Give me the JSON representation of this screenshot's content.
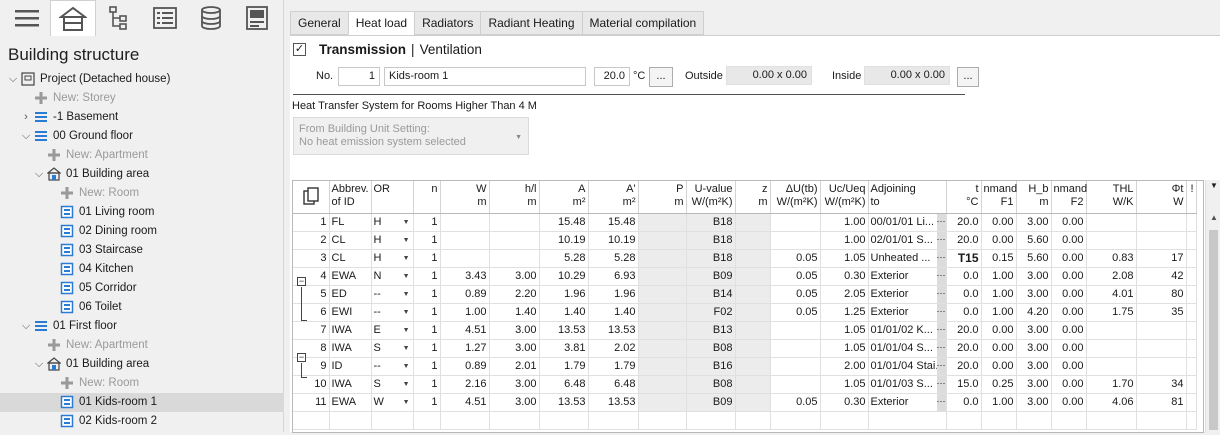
{
  "sidebar": {
    "title": "Building structure",
    "toolbar_icons": [
      "menu-icon",
      "building-icon",
      "hierarchy-icon",
      "list-icon",
      "database-icon",
      "panel-icon"
    ],
    "tree": [
      {
        "level": 0,
        "arrow": "v",
        "icon": "project",
        "label": "Project (Detached house)",
        "grey": false
      },
      {
        "level": 1,
        "arrow": "",
        "icon": "plus",
        "label": "New: Storey",
        "grey": true
      },
      {
        "level": 1,
        "arrow": ">",
        "icon": "storey",
        "label": "-1 Basement",
        "grey": false
      },
      {
        "level": 1,
        "arrow": "v",
        "icon": "storey",
        "label": "00 Ground floor",
        "grey": false
      },
      {
        "level": 2,
        "arrow": "",
        "icon": "plus",
        "label": "New: Apartment",
        "grey": true
      },
      {
        "level": 2,
        "arrow": "v",
        "icon": "area",
        "label": "01 Building area",
        "grey": false
      },
      {
        "level": 3,
        "arrow": "",
        "icon": "plus",
        "label": "New: Room",
        "grey": true
      },
      {
        "level": 3,
        "arrow": "",
        "icon": "room",
        "label": "01 Living room",
        "grey": false
      },
      {
        "level": 3,
        "arrow": "",
        "icon": "room",
        "label": "02 Dining room",
        "grey": false
      },
      {
        "level": 3,
        "arrow": "",
        "icon": "room",
        "label": "03 Staircase",
        "grey": false
      },
      {
        "level": 3,
        "arrow": "",
        "icon": "room",
        "label": "04 Kitchen",
        "grey": false
      },
      {
        "level": 3,
        "arrow": "",
        "icon": "room",
        "label": "05 Corridor",
        "grey": false
      },
      {
        "level": 3,
        "arrow": "",
        "icon": "room",
        "label": "06 Toilet",
        "grey": false
      },
      {
        "level": 1,
        "arrow": "v",
        "icon": "storey",
        "label": "01 First floor",
        "grey": false
      },
      {
        "level": 2,
        "arrow": "",
        "icon": "plus",
        "label": "New: Apartment",
        "grey": true
      },
      {
        "level": 2,
        "arrow": "v",
        "icon": "area",
        "label": "01 Building area",
        "grey": false
      },
      {
        "level": 3,
        "arrow": "",
        "icon": "plus",
        "label": "New: Room",
        "grey": true
      },
      {
        "level": 3,
        "arrow": "",
        "icon": "room",
        "label": "01 Kids-room 1",
        "grey": false,
        "selected": true
      },
      {
        "level": 3,
        "arrow": "",
        "icon": "room",
        "label": "02 Kids-room 2",
        "grey": false
      }
    ]
  },
  "tabs": [
    "General",
    "Heat load",
    "Radiators",
    "Radiant Heating",
    "Material compilation"
  ],
  "active_tab": "Heat load",
  "header": {
    "transmission": "Transmission",
    "separator": "|",
    "ventilation": "Ventilation",
    "checked": "✓"
  },
  "room": {
    "no_label": "No.",
    "no_value": "1",
    "name": "Kids-room 1",
    "temp": "20.0",
    "temp_unit": "°C",
    "dots": "...",
    "outside_label": "Outside",
    "outside_value": "0.00 x 0.00",
    "inside_label": "Inside",
    "inside_value": "0.00 x 0.00"
  },
  "hts": {
    "label": "Heat Transfer System for Rooms Higher Than 4 M",
    "line1": "From Building Unit Setting:",
    "line2": "No heat emission system selected"
  },
  "table": {
    "columns": [
      {
        "h1": "",
        "h2": ""
      },
      {
        "h1": "Abbrev.",
        "h2": "of ID"
      },
      {
        "h1": "OR",
        "h2": ""
      },
      {
        "h1": "n",
        "h2": ""
      },
      {
        "h1": "W",
        "h2": "m"
      },
      {
        "h1": "h/l",
        "h2": "m"
      },
      {
        "h1": "A",
        "h2": "m²"
      },
      {
        "h1": "A'",
        "h2": "m²"
      },
      {
        "h1": "P",
        "h2": "m"
      },
      {
        "h1": "U-value",
        "h2": "W/(m²K)"
      },
      {
        "h1": "z",
        "h2": "m"
      },
      {
        "h1": "ΔU(tb)",
        "h2": "W/(m²K)"
      },
      {
        "h1": "Uc/Ueq",
        "h2": "W/(m²K)"
      },
      {
        "h1": "Adjoining",
        "h2": "to"
      },
      {
        "h1": "t",
        "h2": "°C"
      },
      {
        "h1": "nmand",
        "h2": "F1"
      },
      {
        "h1": "H_b",
        "h2": "m"
      },
      {
        "h1": "nmand",
        "h2": "F2"
      },
      {
        "h1": "THL",
        "h2": "W/K"
      },
      {
        "h1": "Φt",
        "h2": "W"
      },
      {
        "h1": "!",
        "h2": ""
      }
    ],
    "rows": [
      {
        "no": "1",
        "id": "FL",
        "or": "H",
        "n": "1",
        "w": "",
        "h": "",
        "a": "15.48",
        "a2": "15.48",
        "p": "",
        "u": "B18",
        "z": "",
        "du": "",
        "uc": "1.00",
        "adj": "00/01/01 Li...",
        "t": "20.0",
        "f1": "0.00",
        "hb": "3.00",
        "f2": "0.00",
        "thl": "",
        "phi": ""
      },
      {
        "no": "2",
        "id": "CL",
        "or": "H",
        "n": "1",
        "w": "",
        "h": "",
        "a": "10.19",
        "a2": "10.19",
        "p": "",
        "u": "B18",
        "z": "",
        "du": "",
        "uc": "1.00",
        "adj": "02/01/01 S...",
        "t": "20.0",
        "f1": "0.00",
        "hb": "5.60",
        "f2": "0.00",
        "thl": "",
        "phi": ""
      },
      {
        "no": "3",
        "id": "CL",
        "or": "H",
        "n": "1",
        "w": "",
        "h": "",
        "a": "5.28",
        "a2": "5.28",
        "p": "",
        "u": "B18",
        "z": "",
        "du": "0.05",
        "uc": "1.05",
        "adj": "Unheated ...",
        "t": "T15",
        "f1": "0.15",
        "hb": "5.60",
        "f2": "0.00",
        "thl": "0.83",
        "phi": "17"
      },
      {
        "no": "4",
        "id": "EWA",
        "or": "N",
        "n": "1",
        "w": "3.43",
        "h": "3.00",
        "a": "10.29",
        "a2": "6.93",
        "p": "",
        "u": "B09",
        "z": "",
        "du": "0.05",
        "uc": "0.30",
        "adj": "Exterior",
        "t": "0.0",
        "f1": "1.00",
        "hb": "3.00",
        "f2": "0.00",
        "thl": "2.08",
        "phi": "42"
      },
      {
        "no": "5",
        "id": "ED",
        "or": "--",
        "n": "1",
        "w": "0.89",
        "h": "2.20",
        "a": "1.96",
        "a2": "1.96",
        "p": "",
        "u": "B14",
        "z": "",
        "du": "0.05",
        "uc": "2.05",
        "adj": "Exterior",
        "t": "0.0",
        "f1": "1.00",
        "hb": "3.00",
        "f2": "0.00",
        "thl": "4.01",
        "phi": "80"
      },
      {
        "no": "6",
        "id": "EWI",
        "or": "--",
        "n": "1",
        "w": "1.00",
        "h": "1.40",
        "a": "1.40",
        "a2": "1.40",
        "p": "",
        "u": "F02",
        "z": "",
        "du": "0.05",
        "uc": "1.25",
        "adj": "Exterior",
        "t": "0.0",
        "f1": "1.00",
        "hb": "4.20",
        "f2": "0.00",
        "thl": "1.75",
        "phi": "35"
      },
      {
        "no": "7",
        "id": "IWA",
        "or": "E",
        "n": "1",
        "w": "4.51",
        "h": "3.00",
        "a": "13.53",
        "a2": "13.53",
        "p": "",
        "u": "B13",
        "z": "",
        "du": "",
        "uc": "1.05",
        "adj": "01/01/02 K...",
        "t": "20.0",
        "f1": "0.00",
        "hb": "3.00",
        "f2": "0.00",
        "thl": "",
        "phi": ""
      },
      {
        "no": "8",
        "id": "IWA",
        "or": "S",
        "n": "1",
        "w": "1.27",
        "h": "3.00",
        "a": "3.81",
        "a2": "2.02",
        "p": "",
        "u": "B08",
        "z": "",
        "du": "",
        "uc": "1.05",
        "adj": "01/01/04 S...",
        "t": "20.0",
        "f1": "0.00",
        "hb": "3.00",
        "f2": "0.00",
        "thl": "",
        "phi": ""
      },
      {
        "no": "9",
        "id": "ID",
        "or": "--",
        "n": "1",
        "w": "0.89",
        "h": "2.01",
        "a": "1.79",
        "a2": "1.79",
        "p": "",
        "u": "B16",
        "z": "",
        "du": "",
        "uc": "2.00",
        "adj": "01/01/04 Stai...",
        "t": "20.0",
        "f1": "0.00",
        "hb": "3.00",
        "f2": "0.00",
        "thl": "",
        "phi": ""
      },
      {
        "no": "10",
        "id": "IWA",
        "or": "S",
        "n": "1",
        "w": "2.16",
        "h": "3.00",
        "a": "6.48",
        "a2": "6.48",
        "p": "",
        "u": "B08",
        "z": "",
        "du": "",
        "uc": "1.05",
        "adj": "01/01/03 S...",
        "t": "15.0",
        "f1": "0.25",
        "hb": "3.00",
        "f2": "0.00",
        "thl": "1.70",
        "phi": "34"
      },
      {
        "no": "11",
        "id": "EWA",
        "or": "W",
        "n": "1",
        "w": "4.51",
        "h": "3.00",
        "a": "13.53",
        "a2": "13.53",
        "p": "",
        "u": "B09",
        "z": "",
        "du": "0.05",
        "uc": "0.30",
        "adj": "Exterior",
        "t": "0.0",
        "f1": "1.00",
        "hb": "3.00",
        "f2": "0.00",
        "thl": "4.06",
        "phi": "81"
      }
    ]
  }
}
